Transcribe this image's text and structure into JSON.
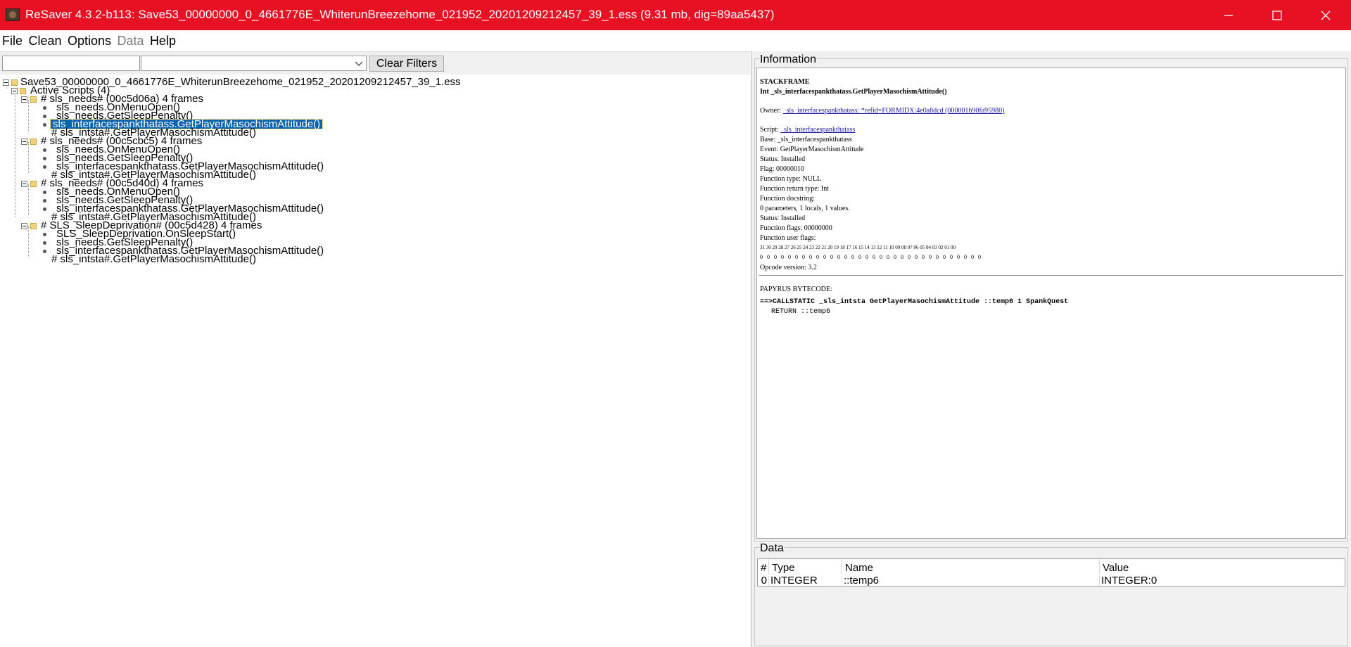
{
  "window": {
    "title": "ReSaver 4.3.2-b113: Save53_00000000_0_4661776E_WhiterunBreezehome_021952_20201209212457_39_1.ess (9.31 mb, dig=89aa5437)",
    "icon": "app-icon",
    "controls": [
      "minimize-icon",
      "maximize-icon",
      "close-icon"
    ]
  },
  "menu": {
    "items": [
      {
        "label": "File",
        "enabled": true
      },
      {
        "label": "Clean",
        "enabled": true
      },
      {
        "label": "Options",
        "enabled": true
      },
      {
        "label": "Data",
        "enabled": false
      },
      {
        "label": "Help",
        "enabled": true
      }
    ]
  },
  "filters": {
    "text_value": "",
    "select_value": "",
    "clear_label": "Clear Filters"
  },
  "tree": {
    "root": "Save53_00000000_0_4661776E_WhiterunBreezehome_021952_20201209212457_39_1.ess",
    "active_scripts": "Active Scripts (4)",
    "groups": [
      {
        "label": "# sls_needs# (00c5d06a) 4 frames",
        "frames": [
          "sls_needs.OnMenuOpen()",
          "sls_needs.GetSleepPenalty()",
          "sls_interfacespankthatass.GetPlayerMasochismAttitude()",
          "# sls_intsta#.GetPlayerMasochismAttitude()"
        ]
      },
      {
        "label": "# sls_needs# (00c5cbc5) 4 frames",
        "frames": [
          "sls_needs.OnMenuOpen()",
          "sls_needs.GetSleepPenalty()",
          "sls_interfacespankthatass.GetPlayerMasochismAttitude()",
          "# sls_intsta#.GetPlayerMasochismAttitude()"
        ]
      },
      {
        "label": "# sls_needs# (00c5d40d) 4 frames",
        "frames": [
          "sls_needs.OnMenuOpen()",
          "sls_needs.GetSleepPenalty()",
          "sls_interfacespankthatass.GetPlayerMasochismAttitude()",
          "# sls_intsta#.GetPlayerMasochismAttitude()"
        ]
      },
      {
        "label": "# SLS_SleepDeprivation# (00c5d428) 4 frames",
        "frames": [
          "SLS_SleepDeprivation.OnSleepStart()",
          "sls_needs.GetSleepPenalty()",
          "sls_interfacespankthatass.GetPlayerMasochismAttitude()",
          "# sls_intsta#.GetPlayerMasochismAttitude()"
        ]
      }
    ],
    "selected": "sls_interfacespankthatass.GetPlayerMasochismAttitude()"
  },
  "info": {
    "group_title": "Information",
    "heading": "STACKFRAME",
    "signature": "Int _sls_interfacespankthatass.GetPlayerMasochismAttitude()",
    "owner_label": "Owner:",
    "owner_link": "_sls_interfacespankthatass: *refid=FORMIDX:4e0a8dcd (000001b90fa95980)",
    "script_label": "Script:",
    "script_link": "_sls_interfacespankthatass",
    "base": "Base: _sls_interfacespankthatass",
    "event": "Event: GetPlayerMasochismAttitude",
    "status": "Status: Installed",
    "flag": "Flag: 00000010",
    "function_type": "Function type: NULL",
    "return_type": "Function return type: Int",
    "docstring": "Function docstring:",
    "params": "0 parameters, 1 locals, 1 values.",
    "status2": "Status: Installed",
    "function_flags": "Function flags: 00000000",
    "user_flags": "Function user flags:",
    "bit_numbers": "31 30 29 28 27 26 25 24 23 22 21 20 19 18 17 16 15 14 13 12 11 10 09 08 07 06 05 04 03 02 01 00",
    "bit_values": "0 0 0 0 0 0 0 0 0 0 0 0 0 0 0 0 0 0 0 0 0 0 0 0 0 0 0 0 0 0 0 0",
    "opcode_version": "Opcode version: 3.2",
    "bytecode_title": "PAPYRUS BYTECODE:",
    "bytecode_line1": "==>CALLSTATIC _sls_intsta GetPlayerMasochismAttitude ::temp6 1 SpankQuest",
    "bytecode_line2": "RETURN ::temp6"
  },
  "data": {
    "group_title": "Data",
    "columns": [
      "#",
      "Type",
      "Name",
      "Value"
    ],
    "rows": [
      {
        "index": "0",
        "type": "INTEGER",
        "name": "::temp6",
        "value": "INTEGER:0"
      }
    ]
  },
  "colors": {
    "titlebar": "#e81123",
    "selection": "#0a64ad",
    "link": "#1a1aa6",
    "folder": "#f1d47a"
  }
}
